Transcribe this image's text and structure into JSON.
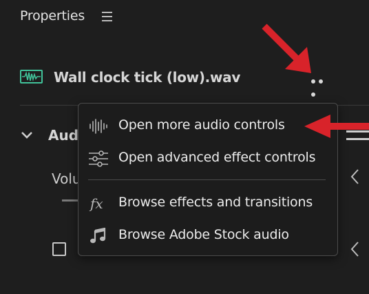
{
  "panel": {
    "title": "Properties",
    "menu_icon": "hamburger-icon"
  },
  "file": {
    "name": "Wall clock tick (low).wav",
    "icon": "audio-waveform-icon",
    "icon_color": "#41c39a"
  },
  "section": {
    "label": "Audi",
    "volume_label": "Volu"
  },
  "context_menu": {
    "items": [
      {
        "label": "Open more audio controls",
        "icon": "audio-levels-icon"
      },
      {
        "label": "Open advanced effect controls",
        "icon": "sliders-icon"
      },
      {
        "label": "Browse effects and transitions",
        "icon": "fx-icon"
      },
      {
        "label": "Browse Adobe Stock audio",
        "icon": "music-note-icon"
      }
    ]
  },
  "colors": {
    "background": "#1e1e1e",
    "menu_bg": "#1c1c1c",
    "annotation_arrow": "#d8232a"
  }
}
